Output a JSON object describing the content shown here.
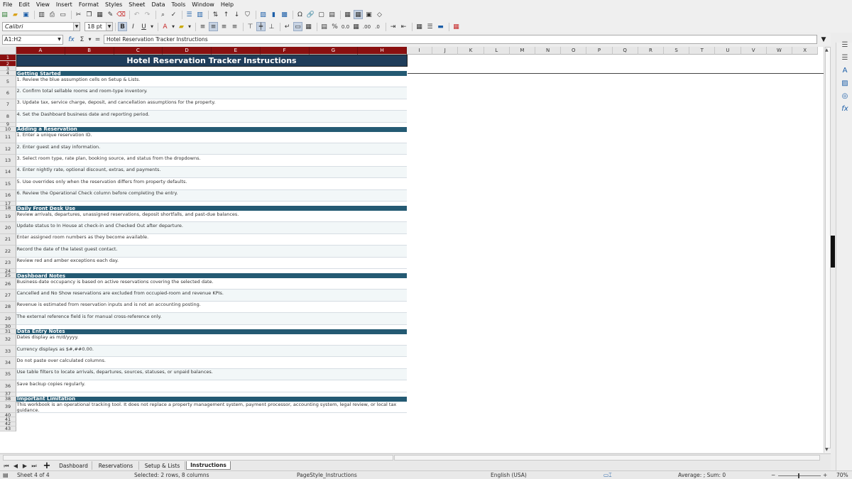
{
  "menu": [
    "File",
    "Edit",
    "View",
    "Insert",
    "Format",
    "Styles",
    "Sheet",
    "Data",
    "Tools",
    "Window",
    "Help"
  ],
  "toolbar": {
    "font_name": "Calibri",
    "font_size": "18 pt"
  },
  "formula_bar": {
    "cell_ref": "A1:H2",
    "content": "Hotel Reservation Tracker Instructions"
  },
  "columns": [
    "A",
    "B",
    "C",
    "D",
    "E",
    "F",
    "G",
    "H",
    "I",
    "J",
    "K",
    "L",
    "M",
    "N",
    "O",
    "P",
    "Q",
    "R",
    "S",
    "T",
    "U",
    "V",
    "W",
    "X"
  ],
  "rows": [
    "1",
    "2",
    "3",
    "4",
    "5",
    "6",
    "7",
    "8",
    "9",
    "10",
    "11",
    "12",
    "13",
    "14",
    "15",
    "16",
    "17",
    "18",
    "19",
    "20",
    "21",
    "22",
    "23",
    "24",
    "25",
    "26",
    "27",
    "28",
    "29",
    "30",
    "31",
    "32",
    "33",
    "34",
    "35",
    "36",
    "37",
    "38",
    "39",
    "40",
    "41",
    "42",
    "43"
  ],
  "sheet": {
    "title": "Hotel Reservation Tracker Instructions",
    "sections": [
      {
        "heading": "Getting Started",
        "items": [
          "1. Review the blue assumption cells on Setup & Lists.",
          "2. Confirm total sellable rooms and room-type inventory.",
          "3. Update tax, service charge, deposit, and cancellation assumptions for the property.",
          "4. Set the Dashboard business date and reporting period."
        ]
      },
      {
        "heading": "Adding a Reservation",
        "items": [
          "1. Enter a unique reservation ID.",
          "2. Enter guest and stay information.",
          "3. Select room type, rate plan, booking source, and status from the dropdowns.",
          "4. Enter nightly rate, optional discount, extras, and payments.",
          "5. Use overrides only when the reservation differs from property defaults.",
          "6. Review the Operational Check column before completing the entry."
        ]
      },
      {
        "heading": "Daily Front Desk Use",
        "items": [
          "Review arrivals, departures, unassigned reservations, deposit shortfalls, and past-due balances.",
          "Update status to In House at check-in and Checked Out after departure.",
          "Enter assigned room numbers as they become available.",
          "Record the date of the latest guest contact.",
          "Review red and amber exceptions each day."
        ]
      },
      {
        "heading": "Dashboard Notes",
        "items": [
          "Business-date occupancy is based on active reservations covering the selected date.",
          "Cancelled and No Show reservations are excluded from occupied-room and revenue KPIs.",
          "Revenue is estimated from reservation inputs and is not an accounting posting.",
          "The external reference field is for manual cross-reference only."
        ]
      },
      {
        "heading": "Data Entry Notes",
        "items": [
          "Dates display as m/d/yyyy.",
          "Currency displays as $#,##0.00.",
          "Do not paste over calculated columns.",
          "Use table filters to locate arrivals, departures, sources, statuses, or unpaid balances.",
          "Save backup copies regularly."
        ]
      },
      {
        "heading": "Important Limitation",
        "items": [
          "This workbook is an operational tracking tool. It does not replace a property management system, payment processor, accounting system, legal review, or local tax guidance."
        ]
      }
    ]
  },
  "tabs": [
    "Dashboard",
    "Reservations",
    "Setup & Lists",
    "Instructions"
  ],
  "active_tab": "Instructions",
  "status": {
    "sheet": "Sheet 4 of 4",
    "selection": "Selected: 2 rows, 8 columns",
    "page_style": "PageStyle_Instructions",
    "language": "English (USA)",
    "summary": "Average: ; Sum: 0",
    "zoom": "70%"
  }
}
